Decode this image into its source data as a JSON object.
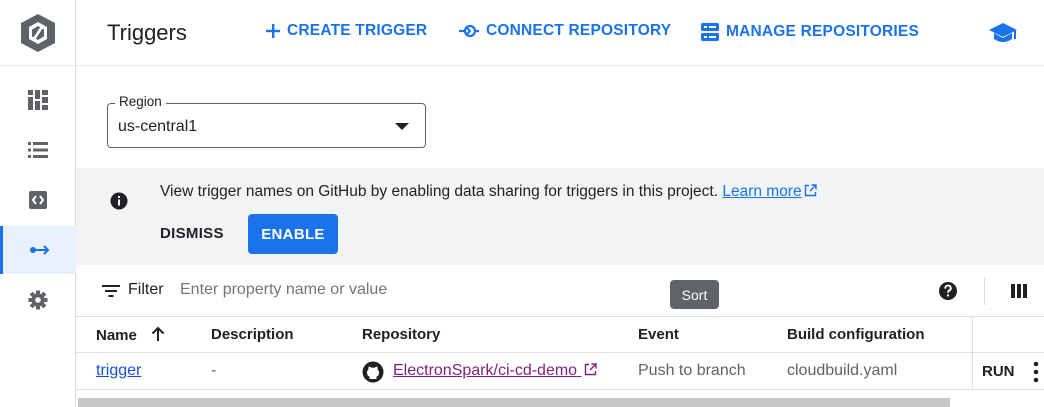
{
  "header": {
    "title": "Triggers",
    "create_trigger": "CREATE TRIGGER",
    "connect_repository": "CONNECT REPOSITORY",
    "manage_repositories": "MANAGE REPOSITORIES"
  },
  "nav": {
    "items": [
      "dashboard-icon",
      "history-list-icon",
      "code-settings-icon",
      "triggers-icon",
      "gear-icon"
    ],
    "active": "triggers-icon"
  },
  "region": {
    "label": "Region",
    "value": "us-central1"
  },
  "banner": {
    "message": "View trigger names on GitHub by enabling data sharing for triggers in this project.",
    "learn_more": "Learn more",
    "dismiss": "DISMISS",
    "enable": "ENABLE"
  },
  "filter": {
    "label": "Filter",
    "placeholder": "Enter property name or value",
    "tooltip": "Sort"
  },
  "table": {
    "columns": [
      "Name",
      "Description",
      "Repository",
      "Event",
      "Build configuration"
    ],
    "rows": [
      {
        "name": "trigger",
        "description": "-",
        "repository": "ElectronSpark/ci-cd-demo",
        "event": "Push to branch",
        "build_configuration": "cloudbuild.yaml",
        "action": "RUN"
      }
    ]
  },
  "colors": {
    "accent": "#1a73e8",
    "banner_bg": "#f1f3f4",
    "active_nav_bg": "#e8f0fe"
  }
}
